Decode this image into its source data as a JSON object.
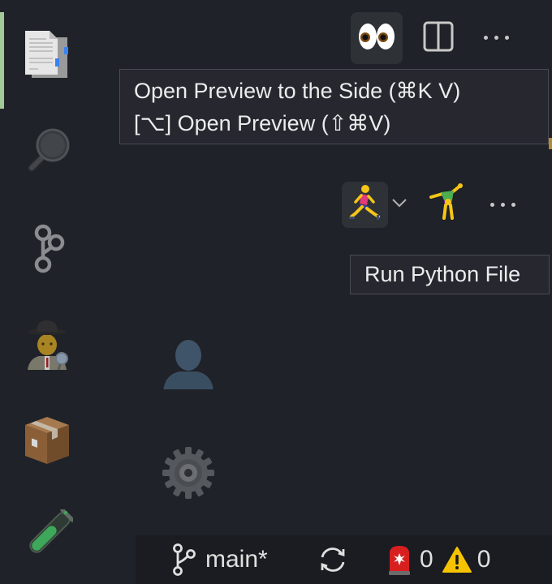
{
  "activity_bar": {
    "items": [
      {
        "name": "explorer",
        "icon": "documents-icon",
        "glyph": "📄",
        "active": true
      },
      {
        "name": "search",
        "icon": "magnifying-glass-icon",
        "glyph": "🔍"
      },
      {
        "name": "source-control",
        "icon": "git-branch-icon"
      },
      {
        "name": "debug",
        "icon": "detective-icon",
        "glyph": "🕵️"
      },
      {
        "name": "extensions",
        "icon": "package-icon",
        "glyph": "📦"
      },
      {
        "name": "testing",
        "icon": "test-tube-icon",
        "glyph": "🧪"
      }
    ],
    "accounts_icon": "👤",
    "settings_icon": "⚙️"
  },
  "editor_toolbar": {
    "preview_button_glyph": "👀",
    "preview_tooltip": {
      "line1": "Open Preview to the Side (⌘K V)",
      "line2": "[⌥] Open Preview (⇧⌘V)"
    }
  },
  "run_toolbar": {
    "run_button_glyph": "🏃",
    "debug_button_glyph": "🤸",
    "run_tooltip": "Run Python File"
  },
  "status_bar": {
    "branch": "main*",
    "errors": "0",
    "warnings": "0",
    "error_glyph": "🚨",
    "warning_glyph": "⚠️"
  },
  "colors": {
    "background": "#1f2228",
    "active_indicator": "#a3c99a",
    "tooltip_bg": "#26272f",
    "statusbar_bg": "#1a1c21"
  }
}
